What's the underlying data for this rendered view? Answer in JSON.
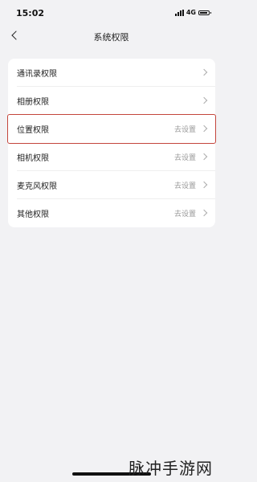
{
  "status_bar": {
    "time": "15:02",
    "network": "4G",
    "battery_level": 0.9
  },
  "nav": {
    "title": "系统权限"
  },
  "permissions": [
    {
      "label": "通讯录权限",
      "value": ""
    },
    {
      "label": "相册权限",
      "value": ""
    },
    {
      "label": "位置权限",
      "value": "去设置"
    },
    {
      "label": "相机权限",
      "value": "去设置"
    },
    {
      "label": "麦克风权限",
      "value": "去设置"
    },
    {
      "label": "其他权限",
      "value": "去设置"
    }
  ],
  "watermark": "脉冲手游网",
  "colors": {
    "highlight": "#c4453c",
    "background": "#f2f2f4"
  },
  "icons": {
    "back": "chevron-left-icon",
    "row": "chevron-right-icon"
  }
}
